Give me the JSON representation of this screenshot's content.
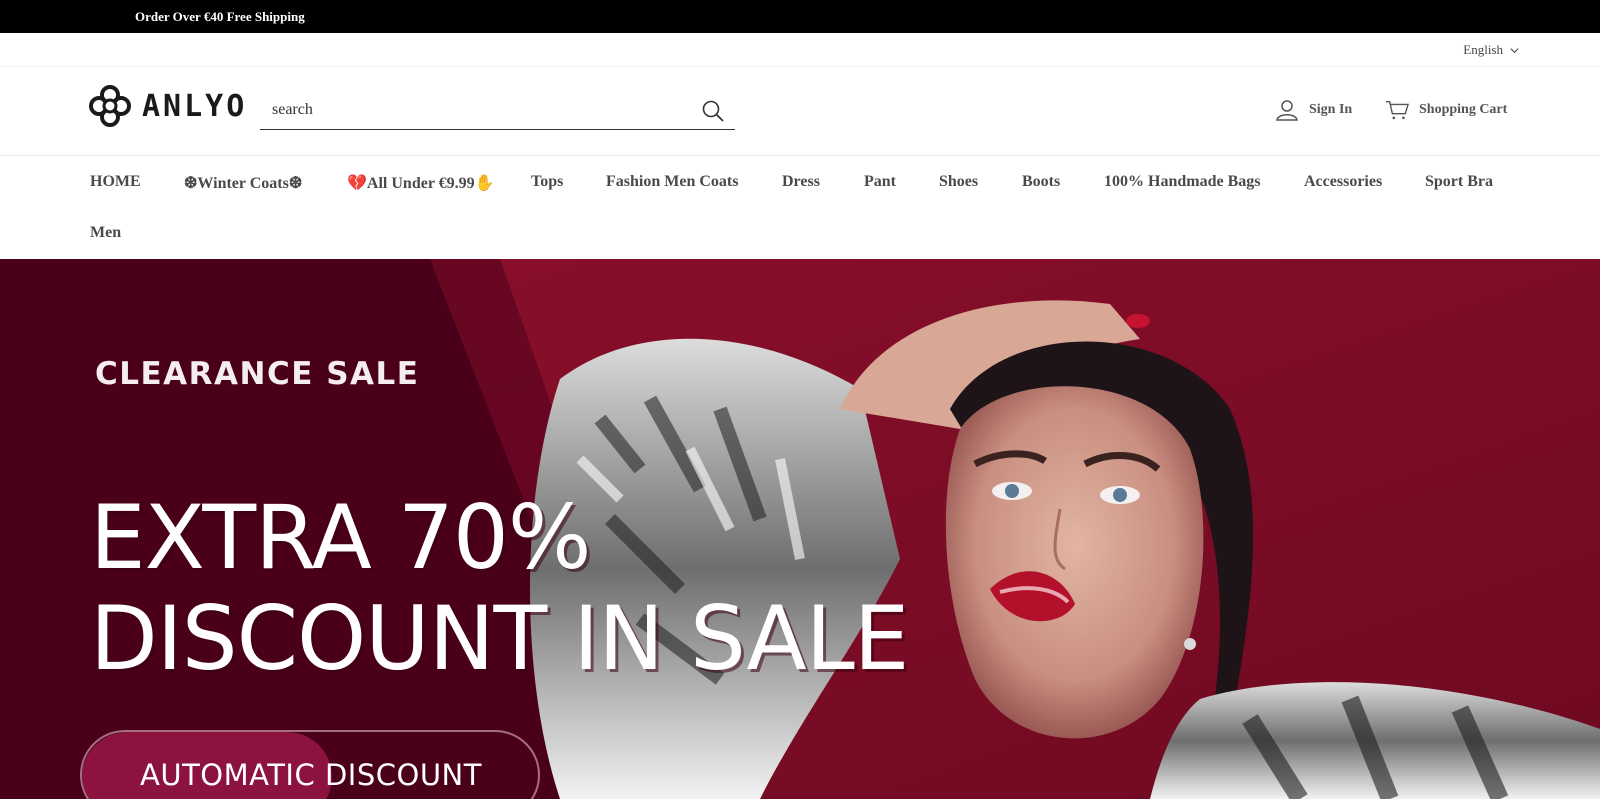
{
  "announcement": {
    "text": "Order Over €40 Free Shipping"
  },
  "language": {
    "selected": "English"
  },
  "logo": {
    "text": "ANLYO"
  },
  "search": {
    "placeholder": "search"
  },
  "account": {
    "sign_in_label": "Sign In",
    "cart_label": "Shopping Cart"
  },
  "nav": {
    "items": [
      {
        "label": "HOME"
      },
      {
        "label": "❆Winter Coats❆"
      },
      {
        "label": "💔All Under €9.99✋"
      },
      {
        "label": "Tops"
      },
      {
        "label": "Fashion Men Coats"
      },
      {
        "label": "Dress"
      },
      {
        "label": "Pant"
      },
      {
        "label": "Shoes"
      },
      {
        "label": "Boots"
      },
      {
        "label": "100% Handmade Bags"
      },
      {
        "label": "Accessories"
      },
      {
        "label": "Sport Bra"
      },
      {
        "label": "Men"
      }
    ]
  },
  "hero": {
    "kicker": "CLEARANCE SALE",
    "headline_line1": "EXTRA 70%",
    "headline_line2": "DISCOUNT IN SALE",
    "cta_label": "AUTOMATIC DISCOUNT"
  },
  "colors": {
    "announcement_bg": "#000000",
    "hero_dark": "#4a0019",
    "hero_red": "#8a0f2a",
    "cta_fill": "#8c1240"
  },
  "icons": {
    "language_caret": "chevron-down-icon",
    "search": "search-icon",
    "account": "user-icon",
    "cart": "cart-icon",
    "logo_mark": "quatrefoil-logo-icon"
  }
}
